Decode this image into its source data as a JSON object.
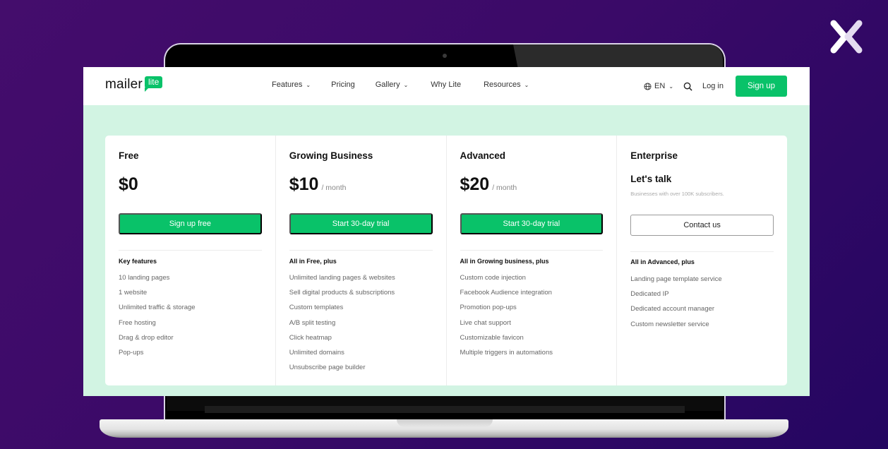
{
  "nav": {
    "logo_word": "mailer",
    "logo_badge": "lite",
    "links": [
      {
        "label": "Features",
        "dropdown": true
      },
      {
        "label": "Pricing",
        "dropdown": false
      },
      {
        "label": "Gallery",
        "dropdown": true
      },
      {
        "label": "Why Lite",
        "dropdown": false
      },
      {
        "label": "Resources",
        "dropdown": true
      }
    ],
    "language": "EN",
    "login": "Log in",
    "signup": "Sign up"
  },
  "plans": [
    {
      "name": "Free",
      "price": "$0",
      "period": "",
      "cta": "Sign up free",
      "features_heading": "Key features",
      "features": [
        "10 landing pages",
        "1 website",
        "Unlimited traffic & storage",
        "Free hosting",
        "Drag & drop editor",
        "Pop-ups"
      ]
    },
    {
      "name": "Growing Business",
      "price": "$10",
      "period": "/ month",
      "cta": "Start 30-day trial",
      "features_heading": "All in Free, plus",
      "features": [
        "Unlimited landing pages & websites",
        "Sell digital products & subscriptions",
        "Custom templates",
        "A/B split testing",
        "Click heatmap",
        "Unlimited domains",
        "Unsubscribe page builder"
      ]
    },
    {
      "name": "Advanced",
      "price": "$20",
      "period": "/ month",
      "cta": "Start 30-day trial",
      "features_heading": "All in Growing business, plus",
      "features": [
        "Custom code injection",
        "Facebook Audience integration",
        "Promotion pop-ups",
        "Live chat support",
        "Customizable favicon",
        "Multiple triggers in automations"
      ]
    },
    {
      "name": "Enterprise",
      "headline": "Let's talk",
      "subtext": "Businesses with over 100K subscribers.",
      "cta": "Contact us",
      "features_heading": "All in Advanced, plus",
      "features": [
        "Landing page template service",
        "Dedicated IP",
        "Dedicated account manager",
        "Custom newsletter service"
      ]
    }
  ],
  "colors": {
    "brand_green": "#09c269",
    "screen_bg": "#d2f4e3",
    "page_bg": "#3b0a68"
  }
}
